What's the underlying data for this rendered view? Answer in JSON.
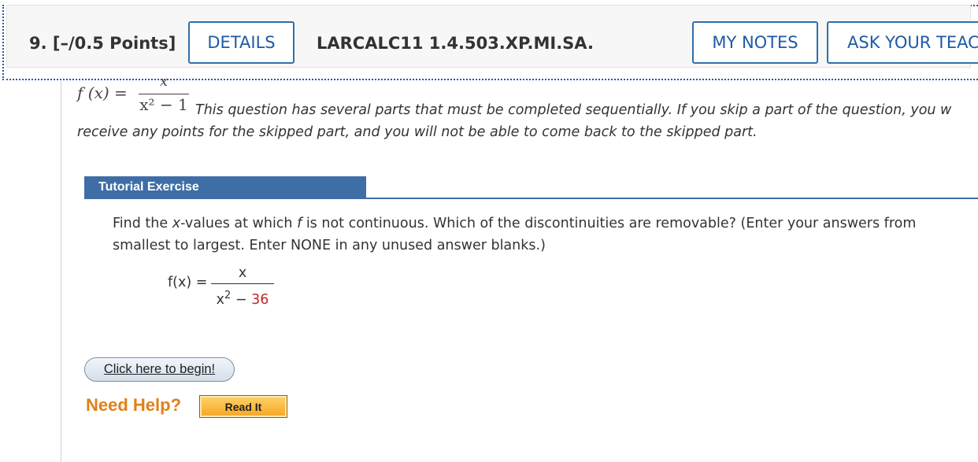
{
  "header": {
    "question_number": "9.",
    "points": "[–/0.5 Points]",
    "details_button": "DETAILS",
    "question_code": "LARCALC11 1.4.503.XP.MI.SA.",
    "my_notes_button": "MY NOTES",
    "ask_teacher_button": "ASK YOUR TEAC"
  },
  "prompt": {
    "fx_label": "f (x) =",
    "fx_numerator": "x",
    "fx_denominator": "x² − 1",
    "intro_line1": "This question has several parts that must be completed sequentially. If you skip a part of the question, you w",
    "intro_line2": "receive any points for the skipped part, and you will not be able to come back to the skipped part."
  },
  "tutorial": {
    "tab_title": "Tutorial Exercise",
    "task_parts": {
      "a": "Find the ",
      "x": "x",
      "b": "-values at which ",
      "f": "f",
      "c": " is not continuous. Which of the discontinuities are removable? (Enter your answers from smallest to largest. Enter NONE in any unused answer blanks.)"
    },
    "function_label": "f(x) =",
    "numerator": "x",
    "denominator_var": "x",
    "denominator_exp": "2",
    "denominator_op": " − ",
    "denominator_const": "36",
    "begin_button": "Click here to begin!"
  },
  "help": {
    "label": "Need Help?",
    "read_it_button": "Read It"
  },
  "colors": {
    "accent_blue": "#1f5aa6",
    "tab_blue": "#3f6ea6",
    "help_orange": "#e1801a",
    "value_red": "#c0282d"
  }
}
